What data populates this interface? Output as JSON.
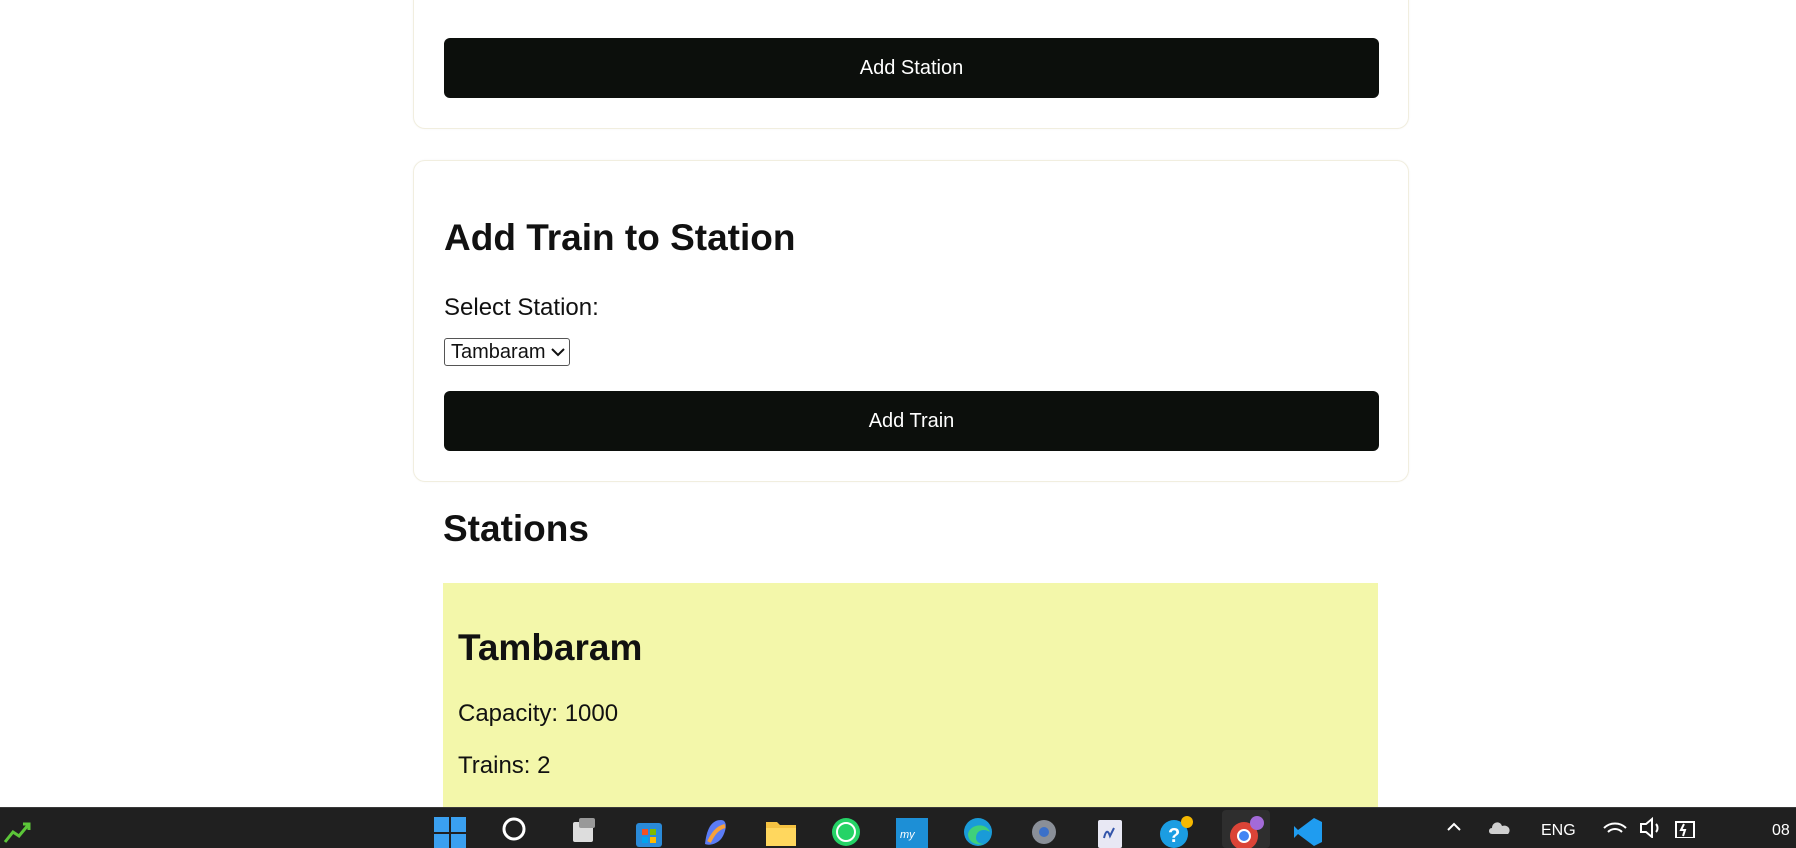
{
  "add_station_card": {
    "button_label": "Add Station"
  },
  "add_train_card": {
    "title": "Add Train to Station",
    "select_label": "Select Station:",
    "selected_station": "Tambaram",
    "button_label": "Add Train"
  },
  "stations_section": {
    "title": "Stations",
    "stations": [
      {
        "name": "Tambaram",
        "capacity": "Capacity: 1000",
        "trains": "Trains: 2"
      }
    ]
  },
  "taskbar": {
    "language": "ENG",
    "clock": "08"
  },
  "colors": {
    "button_bg": "#0c0f0c",
    "station_card_bg": "#f3f7aa",
    "taskbar_bg": "#202020"
  }
}
